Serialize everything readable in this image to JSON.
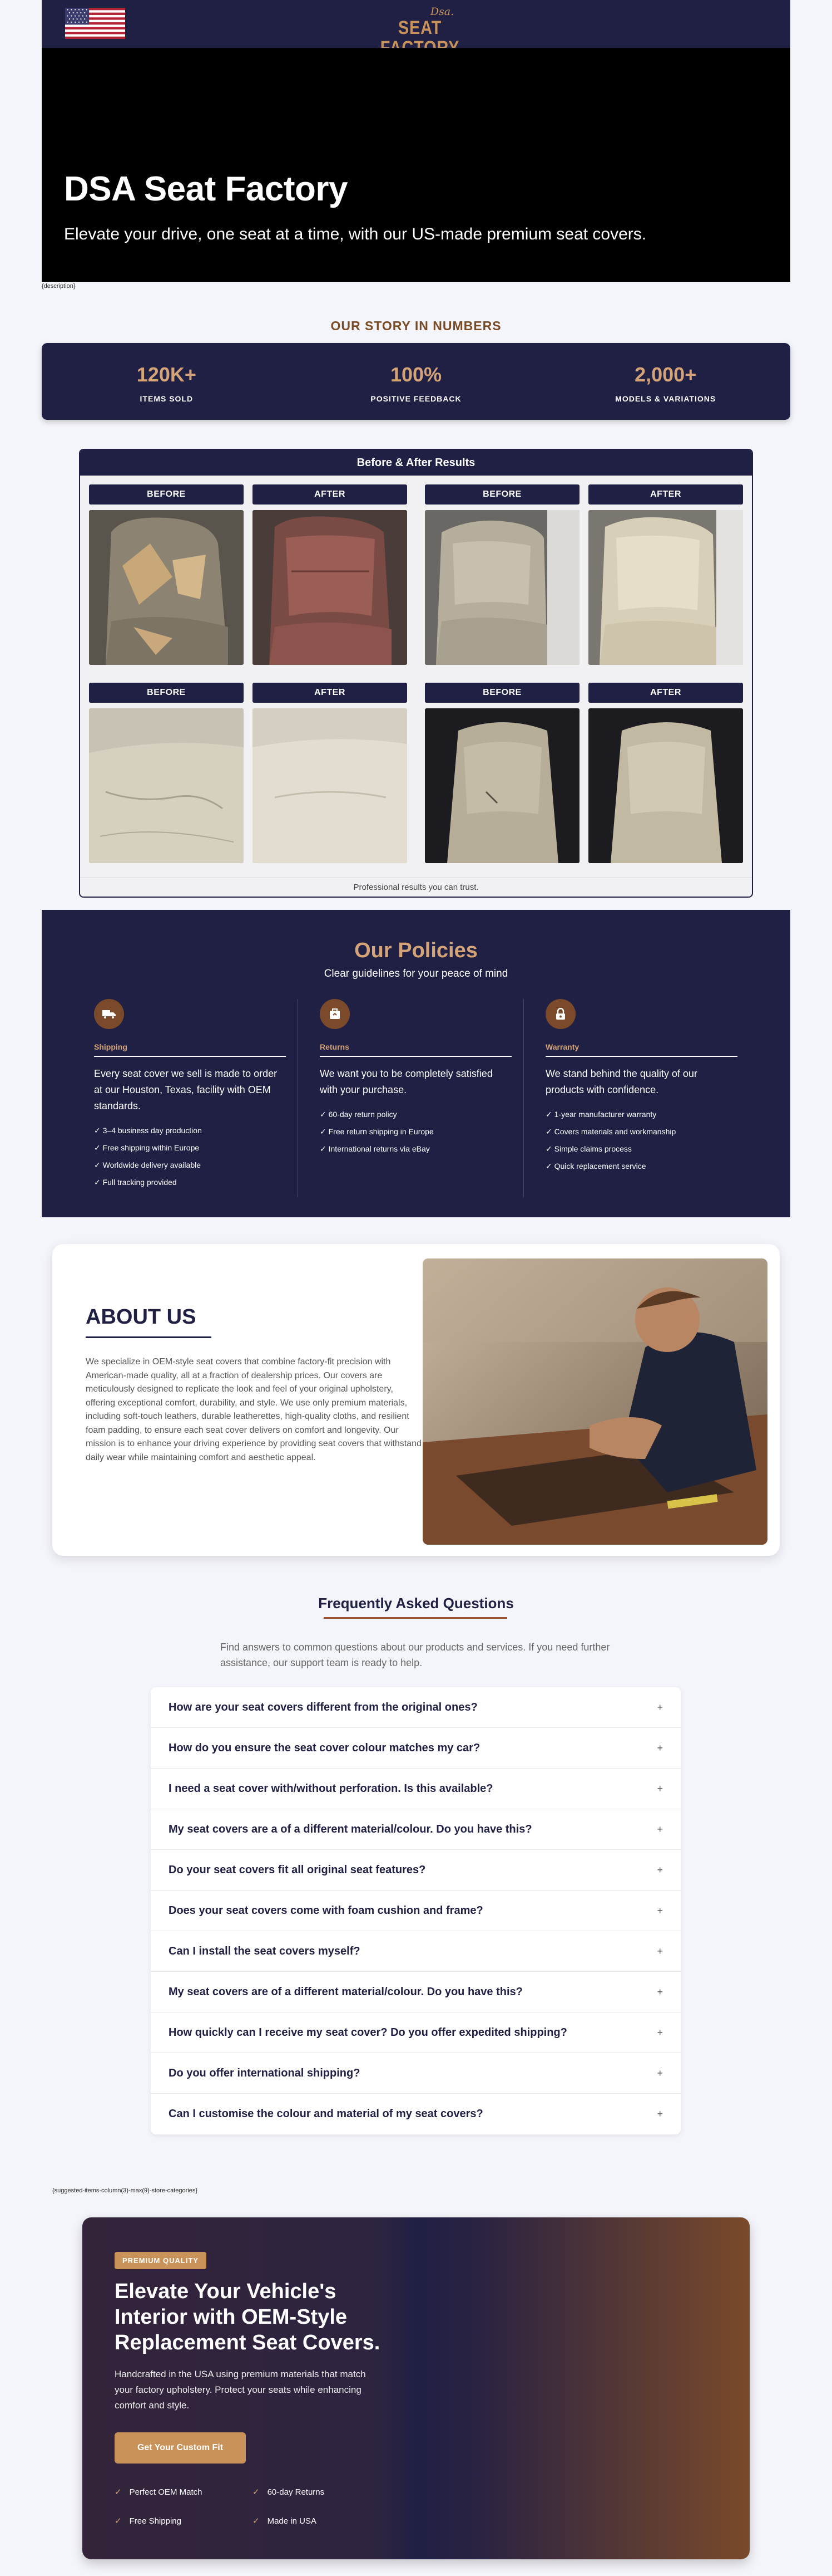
{
  "header": {
    "logo_dsa": "Dsa.",
    "logo_main": "SEAT FACTORY",
    "flag_icon": "us-flag-icon"
  },
  "hero": {
    "title": "DSA Seat Factory",
    "subtitle": "Elevate your drive, one seat at a time, with our US-made premium seat covers.",
    "desc_placeholder": "{description}"
  },
  "story": {
    "heading": "OUR STORY IN NUMBERS",
    "stats": [
      {
        "value": "120K+",
        "label": "ITEMS SOLD"
      },
      {
        "value": "100%",
        "label": "POSITIVE FEEDBACK"
      },
      {
        "value": "2,000+",
        "label": "MODELS & VARIATIONS"
      }
    ]
  },
  "before_after": {
    "title": "Before & After Results",
    "labels": [
      "BEFORE",
      "AFTER",
      "BEFORE",
      "AFTER",
      "BEFORE",
      "AFTER",
      "BEFORE",
      "AFTER"
    ],
    "footer": "Professional results you can trust."
  },
  "policies": {
    "title": "Our Policies",
    "subtitle": "Clear guidelines for your peace of mind",
    "columns": [
      {
        "icon": "truck-icon",
        "name": "Shipping",
        "text": "Every seat cover we sell is made to order at our Houston, Texas, facility with OEM standards.",
        "items": [
          "3–4 business day production",
          "Free shipping within Europe",
          "Worldwide delivery available",
          "Full tracking provided"
        ]
      },
      {
        "icon": "return-box-icon",
        "name": "Returns",
        "text": "We want you to be completely satisfied with your purchase.",
        "items": [
          "60-day return policy",
          "Free return shipping in Europe",
          "International returns via eBay"
        ]
      },
      {
        "icon": "lock-icon",
        "name": "Warranty",
        "text": "We stand behind the quality of our products with confidence.",
        "items": [
          "1-year manufacturer warranty",
          "Covers materials and workmanship",
          "Simple claims process",
          "Quick replacement service"
        ]
      }
    ]
  },
  "about": {
    "title": "ABOUT US",
    "text": "We specialize in OEM-style seat covers that combine factory-fit precision with American-made quality, all at a fraction of dealership prices. Our covers are meticulously designed to replicate the look and feel of your original upholstery, offering exceptional comfort, durability, and style. We use only premium materials, including soft-touch leathers, durable leatherettes, high-quality cloths, and resilient foam padding, to ensure each seat cover delivers on comfort and longevity. Our mission is to enhance your driving experience by providing seat covers that withstand daily wear while maintaining comfort and aesthetic appeal."
  },
  "faq": {
    "title": "Frequently Asked Questions",
    "intro": "Find answers to common questions about our products and services. If you need further assistance, our support team is ready to help.",
    "questions": [
      "How are your seat covers different from the original ones?",
      "How do you ensure the seat cover colour matches my car?",
      "I need a seat cover with/without perforation. Is this available?",
      "My seat covers are a of a different material/colour. Do you have this?",
      "Do your seat covers fit all original seat features?",
      "Does your seat covers come with foam cushion and frame?",
      "Can I install the seat covers myself?",
      "My seat covers are of a different material/colour. Do you have this?",
      "How quickly can I receive my seat cover? Do you offer expedited shipping?",
      "Do you offer international shipping?",
      "Can I customise the colour and material of my seat covers?"
    ],
    "expand_symbol": "+"
  },
  "suggested_placeholder": "{suggested-items-column(3)-max(9)-store-categories}",
  "cta": {
    "badge": "PREMIUM QUALITY",
    "title": "Elevate Your Vehicle's Interior with OEM-Style Replacement Seat Covers.",
    "text": "Handcrafted in the USA using premium materials that match your factory upholstery. Protect your seats while enhancing comfort and style.",
    "button": "Get Your Custom Fit",
    "features": [
      "Perfect OEM Match",
      "60-day Returns",
      "Free Shipping",
      "Made in USA"
    ]
  },
  "colors": {
    "navy": "#1f2044",
    "copper": "#c99258",
    "brown": "#7a4a2a"
  }
}
